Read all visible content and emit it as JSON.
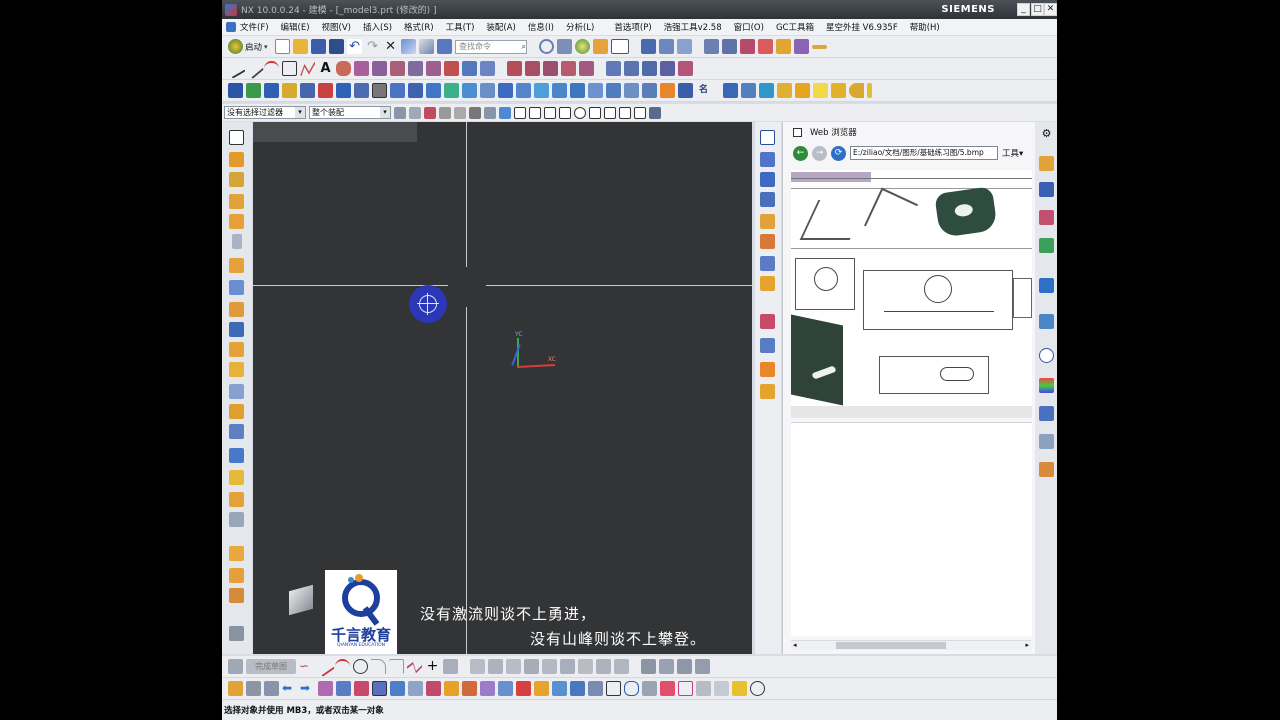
{
  "window": {
    "title": "NX 10.0.0.24 - 建模 - [_model3.prt  (修改的) ]",
    "brand": "SIEMENS",
    "controls": [
      "_",
      "□",
      "✕"
    ]
  },
  "menu": [
    "文件(F)",
    "编辑(E)",
    "视图(V)",
    "插入(S)",
    "格式(R)",
    "工具(T)",
    "装配(A)",
    "信息(I)",
    "分析(L)",
    "首选项(P)",
    "浩强工具v2.58",
    "窗口(O)",
    "GC工具箱",
    "星空外挂 V6.935F",
    "帮助(H)"
  ],
  "toolbar": {
    "start_label": "启动",
    "search_placeholder": "查找命令"
  },
  "filterbar": {
    "filter_value": "没有选择过滤器",
    "scope_value": "整个装配"
  },
  "browser": {
    "title": "Web 浏览器",
    "url": "E:/ziliao/文档/图形/基础练习图/5.bmp",
    "tools_label": "工具"
  },
  "viewport": {
    "triad_x": "XC",
    "triad_y": "YC"
  },
  "bottom": {
    "sketch_label": "完成草图"
  },
  "status": {
    "text": "选择对象并使用 MB3，或者双击某一对象"
  },
  "overlay": {
    "logo_cn": "千言教育",
    "logo_en": "QIANYAN EDUCATION",
    "caption_line1": "没有激流则谈不上勇进，",
    "caption_line2": "没有山峰则谈不上攀登。"
  },
  "colors": {
    "viewport_bg": "#333436",
    "cursor_marker": "#2a37b8",
    "ui_bg": "#eceef2"
  }
}
